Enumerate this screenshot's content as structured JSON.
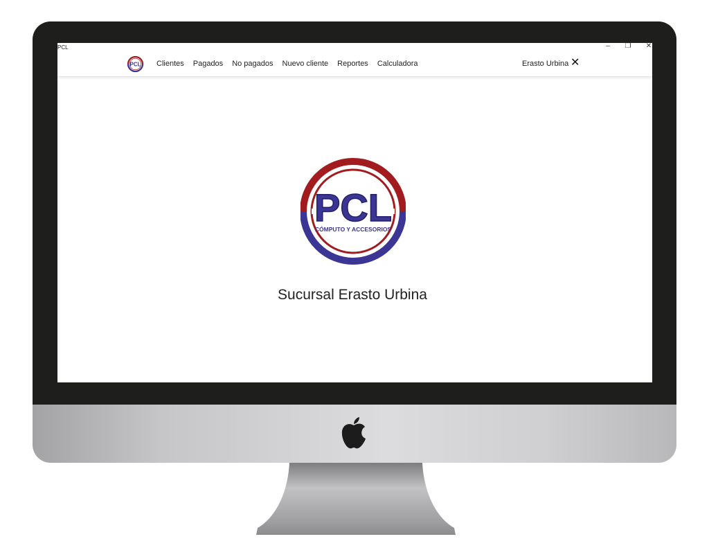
{
  "window": {
    "title": "PCL",
    "controls": {
      "minimize": "–",
      "maximize": "❐",
      "close": "✕"
    }
  },
  "navbar": {
    "logo_text": "PCL",
    "links": [
      "Clientes",
      "Pagados",
      "No pagados",
      "Nuevo cliente",
      "Reportes",
      "Calculadora"
    ],
    "user_name": "Erasto Urbina",
    "logout_icon": "close-icon"
  },
  "main": {
    "logo": {
      "text": "PCL",
      "tagline": "CÓMPUTO Y ACCESORIOS"
    },
    "branch_title": "Sucursal Erasto Urbina"
  },
  "colors": {
    "brand_red": "#a11b1f",
    "brand_blue": "#3b3694",
    "bezel": "#1e1e1c"
  }
}
